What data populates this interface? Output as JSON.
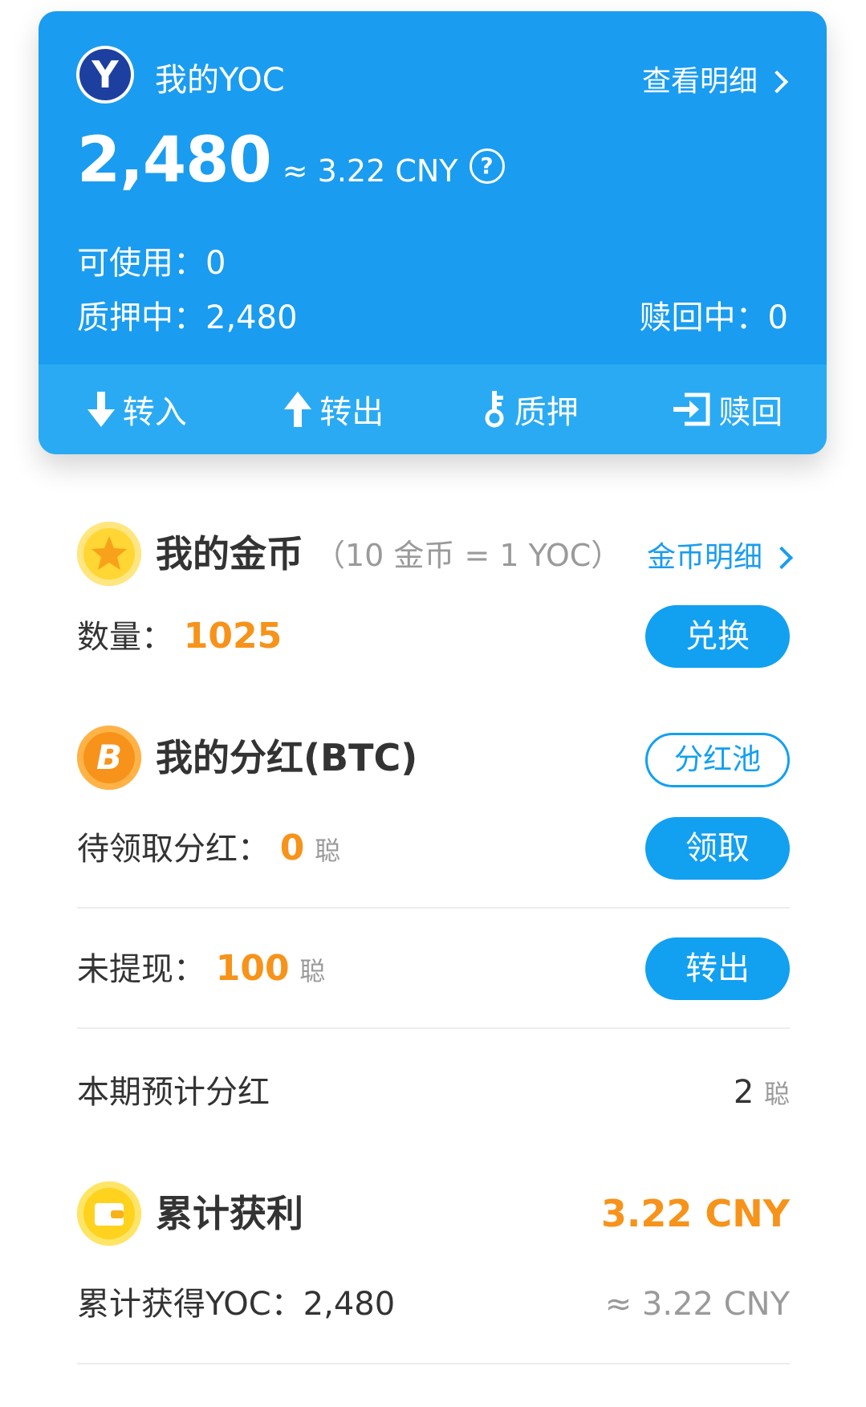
{
  "yoc_card": {
    "title": "我的YOC",
    "detail_link": "查看明细",
    "balance": "2,480",
    "approx_cny": "≈ 3.22 CNY",
    "available_label": "可使用：",
    "available_value": "0",
    "pledged_label": "质押中：",
    "pledged_value": "2,480",
    "redeeming_label": "赎回中：",
    "redeeming_value": "0",
    "actions": [
      {
        "label": "转入",
        "icon": "arrow-down-icon"
      },
      {
        "label": "转出",
        "icon": "arrow-up-icon"
      },
      {
        "label": "质押",
        "icon": "key-icon"
      },
      {
        "label": "赎回",
        "icon": "redeem-icon"
      }
    ],
    "colors": {
      "card_bg": "#1a9cf0",
      "action_bar_bg": "#2aaaf3"
    }
  },
  "gold_coins": {
    "title": "我的金币",
    "rate": "（10 金币 = 1 YOC）",
    "detail_link": "金币明细",
    "quantity_label": "数量：",
    "quantity_value": "1025",
    "exchange_button": "兑换",
    "icon": "gold-coin-star-icon"
  },
  "dividend": {
    "title": "我的分红(BTC)",
    "pool_button": "分红池",
    "pending_label": "待领取分红：",
    "pending_value": "0",
    "pending_unit": "聪",
    "claim_button": "领取",
    "unwithdrawn_label": "未提现：",
    "unwithdrawn_value": "100",
    "unwithdrawn_unit": "聪",
    "transfer_button": "转出",
    "estimate_label": "本期预计分红",
    "estimate_value": "2",
    "estimate_unit": "聪",
    "icon": "bitcoin-icon",
    "icon_letter": "B"
  },
  "profit": {
    "title": "累计获利",
    "total_value": "3.22 CNY",
    "earned_label": "累计获得YOC：",
    "earned_value": "2,480",
    "earned_approx": "≈ 3.22 CNY",
    "icon": "wallet-icon"
  },
  "accent_colors": {
    "blue": "#12a0f1",
    "orange": "#f7931a",
    "gold": "#ffc928"
  }
}
